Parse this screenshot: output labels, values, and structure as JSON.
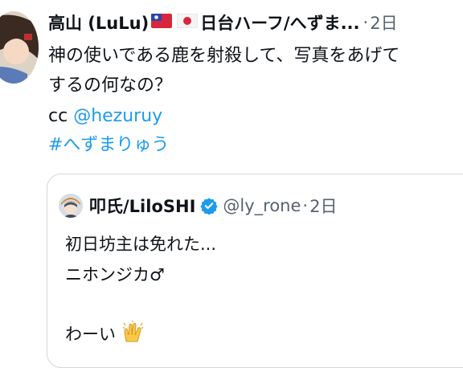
{
  "tweet": {
    "author_name": "高山 (LuLu)",
    "author_tagline": "日台ハーフ/へずま...",
    "flag_icons": [
      "taiwan-flag-icon",
      "japan-flag-icon"
    ],
    "separator": "·",
    "date": "2日",
    "text_lines": [
      "神の使いである鹿を射殺して、写真をあげて",
      "するの何なの？"
    ],
    "cc_prefix": "cc ",
    "mention": "@hezuruy",
    "hashtag": "#へずまりゅう"
  },
  "quoted_tweet": {
    "author_name": "叩氏/LiloSHI",
    "verified_icon": "verified-badge-icon",
    "handle": "@ly_rone",
    "separator": "·",
    "date": "2日",
    "line1": "初日坊主は免れた...",
    "line2": "ニホンジカ♂",
    "line3": "わーい",
    "emoji_icon": "raising-hands-icon"
  },
  "colors": {
    "link": "#1d9bf0",
    "secondary_text": "#536471",
    "border": "#cfd9de",
    "verified": "#1d9bf0"
  }
}
